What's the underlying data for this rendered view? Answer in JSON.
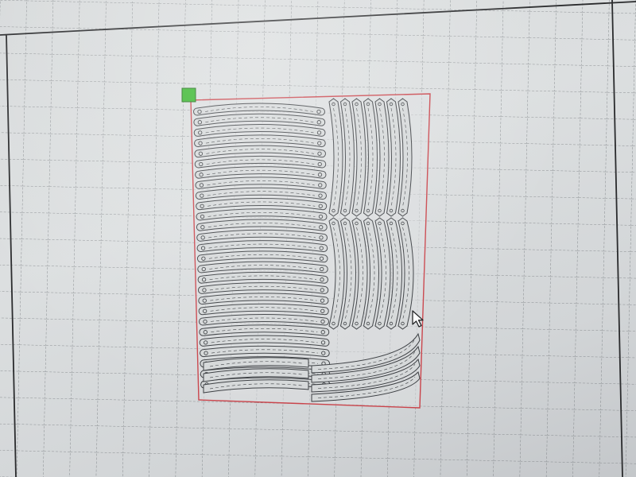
{
  "canvas": {
    "background": "#dcdfe0",
    "grid_color": "#6f7478",
    "grid": true,
    "bed_border_color": "#2a2b2d"
  },
  "design": {
    "selection_color": "#c9434a",
    "anchor_color": "#35b52a",
    "part_stroke": "#3a3d41",
    "part_fill": "#d5d8d9",
    "parts": {
      "left_strips": 27,
      "right_top_strips": 7,
      "right_bottom_strips": 7,
      "bottom_left_arcs": 3,
      "bottom_right_arcs": 4
    }
  },
  "cursor": {
    "icon": "mouse-pointer-icon"
  }
}
